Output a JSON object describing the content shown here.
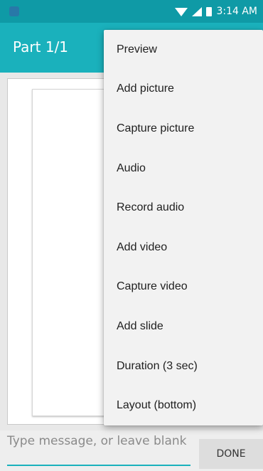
{
  "status_bar": {
    "time": "3:14 AM",
    "icons": [
      "app-notification-icon",
      "wifi-icon",
      "signal-icon",
      "battery-icon"
    ]
  },
  "app_bar": {
    "title": "Part 1/1"
  },
  "compose": {
    "placeholder": "Type message, or leave blank",
    "done_label": "DONE"
  },
  "menu": {
    "items": [
      {
        "label": "Preview"
      },
      {
        "label": "Add picture"
      },
      {
        "label": "Capture picture"
      },
      {
        "label": "Audio"
      },
      {
        "label": "Record audio"
      },
      {
        "label": "Add video"
      },
      {
        "label": "Capture video"
      },
      {
        "label": "Add slide"
      },
      {
        "label": "Duration (3 sec)"
      },
      {
        "label": "Layout (bottom)"
      }
    ]
  },
  "colors": {
    "status_bar": "#0f9aa6",
    "app_bar": "#1ab1bc",
    "accent": "#1ab1bc"
  }
}
